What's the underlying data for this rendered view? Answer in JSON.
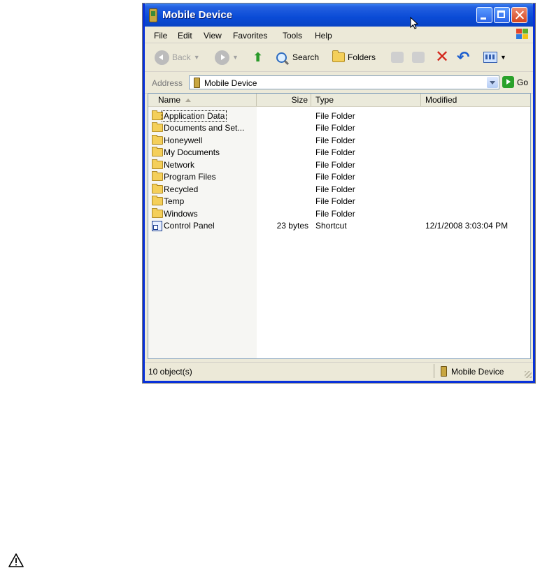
{
  "window": {
    "title": "Mobile Device"
  },
  "menu": [
    "File",
    "Edit",
    "View",
    "Favorites",
    "Tools",
    "Help"
  ],
  "toolbar": {
    "back": "Back",
    "search": "Search",
    "folders": "Folders"
  },
  "address": {
    "label": "Address",
    "value": "Mobile Device",
    "go": "Go"
  },
  "columns": {
    "name": "Name",
    "size": "Size",
    "type": "Type",
    "modified": "Modified"
  },
  "files": [
    {
      "name": "Application Data",
      "size": "",
      "type": "File Folder",
      "modified": "",
      "icon": "folder-icon"
    },
    {
      "name": "Documents and Set...",
      "size": "",
      "type": "File Folder",
      "modified": "",
      "icon": "folder-icon"
    },
    {
      "name": "Honeywell",
      "size": "",
      "type": "File Folder",
      "modified": "",
      "icon": "folder-icon"
    },
    {
      "name": "My Documents",
      "size": "",
      "type": "File Folder",
      "modified": "",
      "icon": "folder-icon"
    },
    {
      "name": "Network",
      "size": "",
      "type": "File Folder",
      "modified": "",
      "icon": "folder-icon"
    },
    {
      "name": "Program Files",
      "size": "",
      "type": "File Folder",
      "modified": "",
      "icon": "folder-icon"
    },
    {
      "name": "Recycled",
      "size": "",
      "type": "File Folder",
      "modified": "",
      "icon": "folder-icon"
    },
    {
      "name": "Temp",
      "size": "",
      "type": "File Folder",
      "modified": "",
      "icon": "folder-icon"
    },
    {
      "name": "Windows",
      "size": "",
      "type": "File Folder",
      "modified": "",
      "icon": "folder-icon"
    },
    {
      "name": "Control Panel",
      "size": "23 bytes",
      "type": "Shortcut",
      "modified": "12/1/2008  3:03:04 PM",
      "icon": "shortcut-icon"
    }
  ],
  "status": {
    "count": "10 object(s)",
    "location": "Mobile Device"
  },
  "colors": {
    "titlebar": "#0a4bd6",
    "chrome": "#ece9d8",
    "close": "#d3451f"
  }
}
